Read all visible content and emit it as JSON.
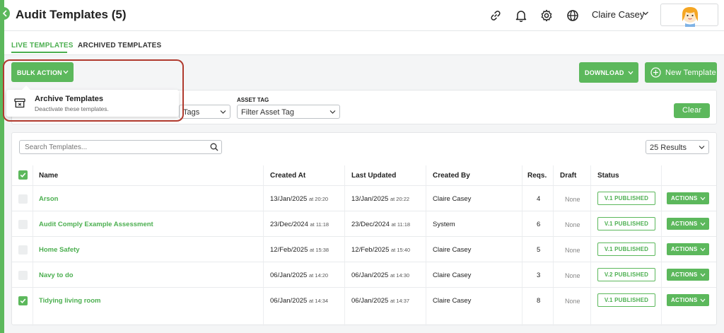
{
  "header": {
    "title": "Audit Templates (5)",
    "user_name": "Claire Casey",
    "icons": [
      "link-icon",
      "bell-icon",
      "gear-icon",
      "globe-icon"
    ]
  },
  "tabs": [
    {
      "label": "LIVE TEMPLATES",
      "active": true
    },
    {
      "label": "ARCHIVED TEMPLATES",
      "active": false
    }
  ],
  "toolbar": {
    "bulk_action_label": "BULK ACTION",
    "download_label": "DOWNLOAD",
    "new_template_label": "New Template"
  },
  "bulk_menu": {
    "items": [
      {
        "title": "Archive Templates",
        "description": "Deactivate these templates.",
        "icon": "archive-box-icon"
      }
    ]
  },
  "filters": {
    "tags_partial_value": "Tags",
    "asset_tag_label": "ASSET TAG",
    "asset_tag_value": "Filter Asset Tag",
    "clear_label": "Clear"
  },
  "table": {
    "search_placeholder": "Search Templates...",
    "results_label": "25 Results",
    "columns": [
      "Name",
      "Created At",
      "Last Updated",
      "Created By",
      "Reqs.",
      "Draft",
      "Status"
    ],
    "header_checkbox_checked": true,
    "rows": [
      {
        "name": "Arson",
        "created_date": "13/Jan/2025",
        "created_time": "at 20:20",
        "updated_date": "13/Jan/2025",
        "updated_time": "at 20:22",
        "created_by": "Claire Casey",
        "reqs": "4",
        "draft": "None",
        "status": "V.1 PUBLISHED",
        "actions": "ACTIONS",
        "checked": false
      },
      {
        "name": "Audit Comply Example Assessment",
        "created_date": "23/Dec/2024",
        "created_time": "at 11:18",
        "updated_date": "23/Dec/2024",
        "updated_time": "at 11:18",
        "created_by": "System",
        "reqs": "6",
        "draft": "None",
        "status": "V.1 PUBLISHED",
        "actions": "ACTIONS",
        "checked": false
      },
      {
        "name": "Home Safety",
        "created_date": "12/Feb/2025",
        "created_time": "at 15:38",
        "updated_date": "12/Feb/2025",
        "updated_time": "at 15:40",
        "created_by": "Claire Casey",
        "reqs": "5",
        "draft": "None",
        "status": "V.1 PUBLISHED",
        "actions": "ACTIONS",
        "checked": false
      },
      {
        "name": "Navy to do",
        "created_date": "06/Jan/2025",
        "created_time": "at 14:20",
        "updated_date": "06/Jan/2025",
        "updated_time": "at 14:30",
        "created_by": "Claire Casey",
        "reqs": "3",
        "draft": "None",
        "status": "V.2 PUBLISHED",
        "actions": "ACTIONS",
        "checked": false
      },
      {
        "name": "Tidying living room",
        "created_date": "06/Jan/2025",
        "created_time": "at 14:34",
        "updated_date": "06/Jan/2025",
        "updated_time": "at 14:37",
        "created_by": "Claire Casey",
        "reqs": "8",
        "draft": "None",
        "status": "V.1 PUBLISHED",
        "actions": "ACTIONS",
        "checked": true
      }
    ]
  },
  "colors": {
    "accent": "#5cb85c",
    "accent_text": "#4caf50",
    "highlight": "#b03a2e"
  }
}
